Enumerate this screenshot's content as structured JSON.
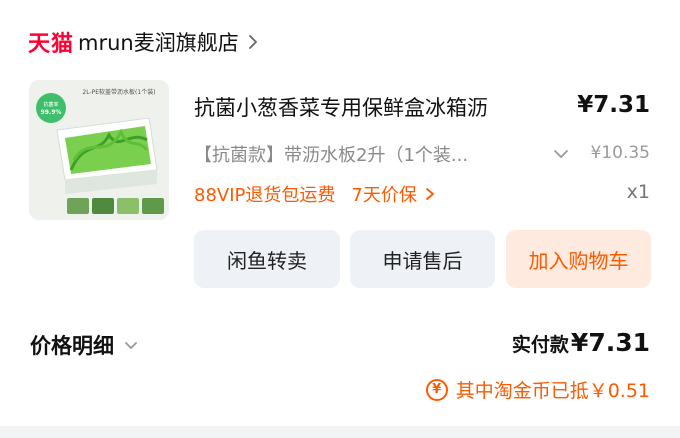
{
  "store": {
    "platform": "天猫",
    "name": "mrun麦润旗舰店",
    "chevron_icon": "chevron-right-icon"
  },
  "product": {
    "thumbnail_label": "2L-PE软盖带沥水板(1个装)",
    "thumbnail_badge_line1": "抗菌率",
    "thumbnail_badge_line2": "99.9%",
    "title": "抗菌小葱香菜专用保鲜盒冰箱沥",
    "price": "¥7.31",
    "sku": "【抗菌款】带沥水板2升（1个装...",
    "original_price": "¥10.35",
    "promo_vip": "88VIP退货包运费",
    "promo_price_protect": "7天价保",
    "quantity": "x1"
  },
  "actions": {
    "resell": "闲鱼转卖",
    "after_sale": "申请售后",
    "add_to_cart": "加入购物车"
  },
  "price_detail": {
    "label": "价格明细",
    "actual_pay_label": "实付款",
    "actual_pay_value": "¥7.31",
    "coin_icon": "¥",
    "coin_text": "其中淘金币已抵￥0.51"
  },
  "colors": {
    "brand_red": "#ff0036",
    "accent_orange": "#ff5a00",
    "button_gray": "#eef1f5",
    "cart_bg": "#ffeadf"
  }
}
